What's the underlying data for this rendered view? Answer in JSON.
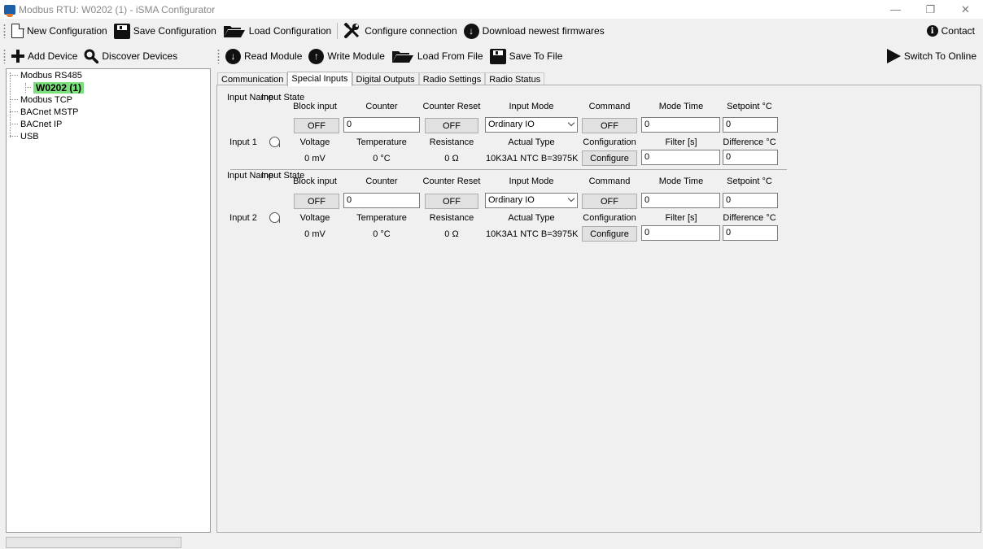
{
  "window": {
    "title": "Modbus RTU: W0202 (1) - iSMA Configurator",
    "minimize_icon": "minimize-icon",
    "restore_icon": "restore-icon",
    "close_icon": "close-icon"
  },
  "main_toolbar": {
    "new_configuration": "New Configuration",
    "save_configuration": "Save Configuration",
    "load_configuration": "Load Configuration",
    "configure_connection": "Configure connection",
    "download_firmwares": "Download newest firmwares",
    "contact": "Contact"
  },
  "device_toolbar": {
    "add_device": "Add Device",
    "discover_devices": "Discover Devices",
    "read_module": "Read Module",
    "write_module": "Write Module",
    "load_from_file": "Load From File",
    "save_to_file": "Save To File",
    "switch_to_online": "Switch To Online"
  },
  "tree": {
    "items": [
      "Modbus RS485",
      "W0202 (1)",
      "Modbus TCP",
      "BACnet MSTP",
      "BACnet IP",
      "USB"
    ],
    "selected": "W0202 (1)",
    "selected_color": "#7be07b"
  },
  "tabs": [
    "Communication",
    "Special Inputs",
    "Digital Outputs",
    "Radio Settings",
    "Radio Status"
  ],
  "active_tab": "Special Inputs",
  "headers": {
    "input_name": "Input Name",
    "input_state": "Input State",
    "block_input": "Block input",
    "counter": "Counter",
    "counter_reset": "Counter Reset",
    "input_mode": "Input Mode",
    "command": "Command",
    "mode_time": "Mode Time",
    "setpoint": "Setpoint °C",
    "voltage": "Voltage",
    "temperature": "Temperature",
    "resistance": "Resistance",
    "actual_type": "Actual Type",
    "configuration": "Configuration",
    "filter": "Filter [s]",
    "difference": "Difference °C"
  },
  "inputs": [
    {
      "name": "Input 1",
      "block_input": "OFF",
      "counter": "0",
      "counter_reset": "OFF",
      "input_mode": "Ordinary IO",
      "command": "OFF",
      "mode_time": "0",
      "setpoint": "0",
      "voltage": "0 mV",
      "temperature": "0 °C",
      "resistance": "0 Ω",
      "actual_type": "10K3A1 NTC B=3975K",
      "configure": "Configure",
      "filter": "0",
      "difference": "0"
    },
    {
      "name": "Input 2",
      "block_input": "OFF",
      "counter": "0",
      "counter_reset": "OFF",
      "input_mode": "Ordinary IO",
      "command": "OFF",
      "mode_time": "0",
      "setpoint": "0",
      "voltage": "0 mV",
      "temperature": "0 °C",
      "resistance": "0 Ω",
      "actual_type": "10K3A1 NTC B=3975K",
      "configure": "Configure",
      "filter": "0",
      "difference": "0"
    }
  ]
}
